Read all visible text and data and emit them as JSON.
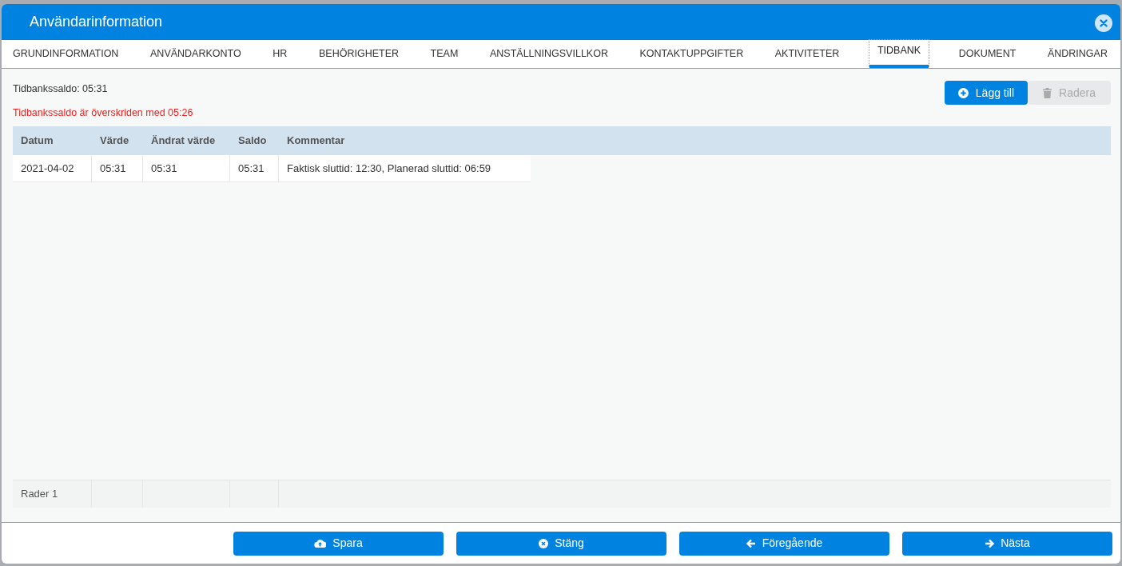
{
  "window": {
    "title": "Användarinformation"
  },
  "tabs": [
    {
      "label": "GRUNDINFORMATION",
      "selected": false
    },
    {
      "label": "ANVÄNDARKONTO",
      "selected": false
    },
    {
      "label": "HR",
      "selected": false
    },
    {
      "label": "BEHÖRIGHETER",
      "selected": false
    },
    {
      "label": "TEAM",
      "selected": false
    },
    {
      "label": "ANSTÄLLNINGSVILLKOR",
      "selected": false
    },
    {
      "label": "KONTAKTUPPGIFTER",
      "selected": false
    },
    {
      "label": "AKTIVITETER",
      "selected": false
    },
    {
      "label": "TIDBANK",
      "selected": true
    },
    {
      "label": "DOKUMENT",
      "selected": false
    },
    {
      "label": "ÄNDRINGAR",
      "selected": false
    }
  ],
  "balance": "Tidbankssaldo: 05:31",
  "warning": "Tidbankssaldo är överskriden med 05:26",
  "toolbar": [
    {
      "label": "Lägg till",
      "kind": "add",
      "disabled": false
    },
    {
      "label": "Radera",
      "kind": "delete",
      "disabled": true
    }
  ],
  "table": {
    "columns": [
      "Datum",
      "Värde",
      "Ändrat värde",
      "Saldo",
      "Kommentar"
    ],
    "rows": [
      [
        "2021-04-02",
        "05:31",
        "05:31",
        "05:31",
        "Faktisk sluttid: 12:30, Planerad sluttid: 06:59"
      ]
    ],
    "footer": "Rader 1"
  },
  "buttons": [
    {
      "label": "Spara",
      "kind": "save"
    },
    {
      "label": "Stäng",
      "kind": "close"
    },
    {
      "label": "Föregående",
      "kind": "prev"
    },
    {
      "label": "Nästa",
      "kind": "next"
    }
  ]
}
